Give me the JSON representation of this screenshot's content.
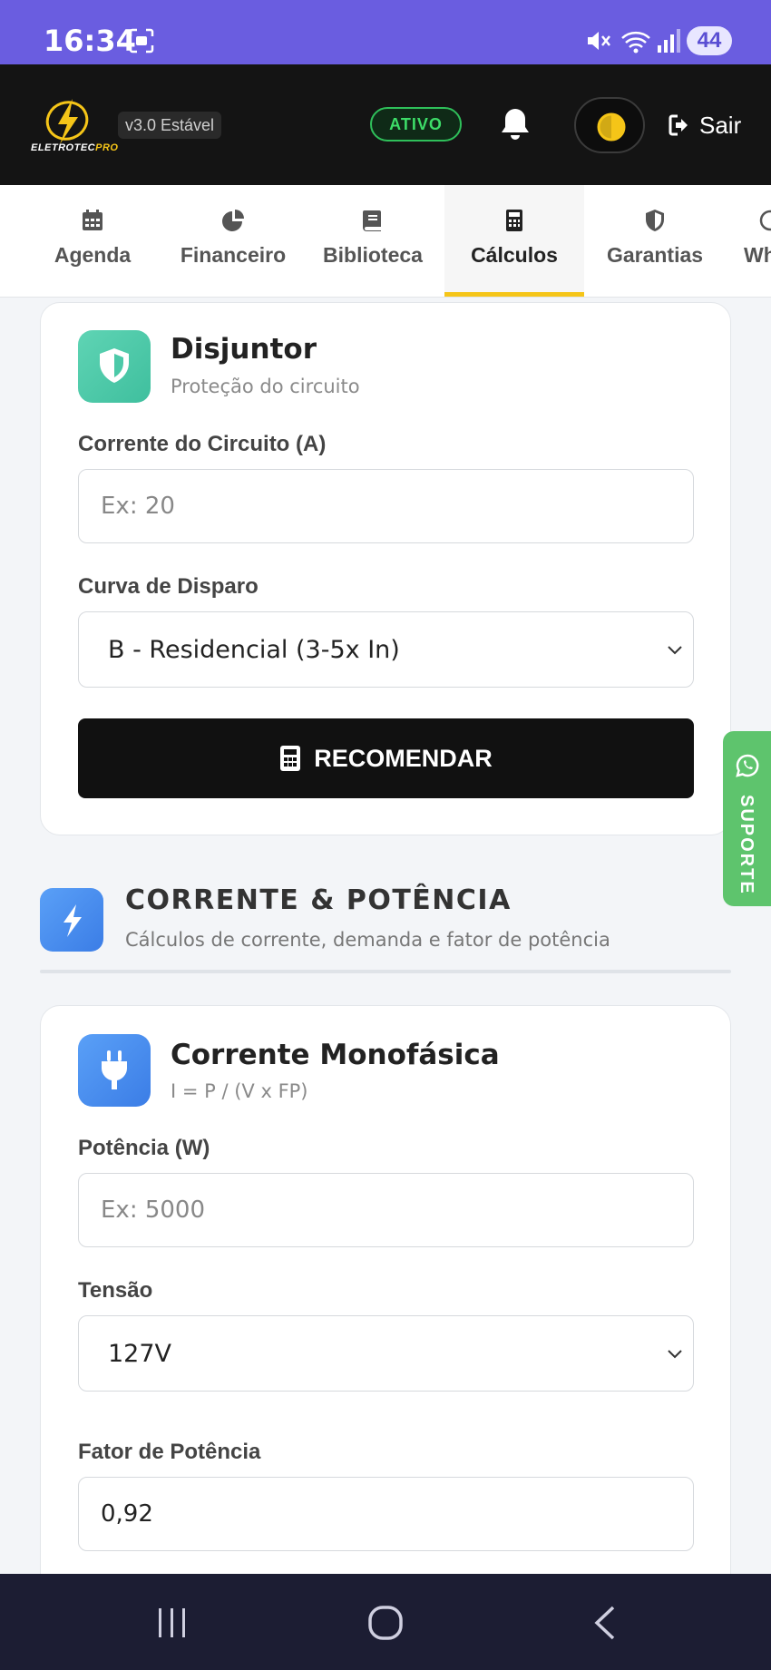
{
  "status_bar": {
    "time": "16:34",
    "battery": "44",
    "icons": [
      "screen-record-icon",
      "mute-icon",
      "wifi-icon",
      "signal-icon",
      "battery-icon"
    ]
  },
  "header": {
    "logo_text_main": "ELETROTEC",
    "logo_text_accent": "PRO",
    "version": "v3.0 Estável",
    "status": "ATIVO",
    "logout_label": "Sair",
    "accent_color": "#f5c518",
    "status_color": "#3ddc68"
  },
  "tabs": [
    {
      "label": "Agenda",
      "icon": "calendar-icon",
      "active": false
    },
    {
      "label": "Financeiro",
      "icon": "pie-chart-icon",
      "active": false
    },
    {
      "label": "Biblioteca",
      "icon": "book-icon",
      "active": false
    },
    {
      "label": "Cálculos",
      "icon": "calculator-icon",
      "active": true
    },
    {
      "label": "Garantias",
      "icon": "shield-icon",
      "active": false
    },
    {
      "label": "WhatsApp",
      "icon": "whatsapp-icon",
      "active": false
    }
  ],
  "breaker_card": {
    "title": "Disjuntor",
    "subtitle": "Proteção do circuito",
    "current_label": "Corrente do Circuito (A)",
    "current_placeholder": "Ex: 20",
    "curve_label": "Curva de Disparo",
    "curve_value": "B - Residencial (3-5x In)",
    "button_label": "RECOMENDAR"
  },
  "section": {
    "title": "CORRENTE & POTÊNCIA",
    "subtitle": "Cálculos de corrente, demanda e fator de potência"
  },
  "single_phase_card": {
    "title": "Corrente Monofásica",
    "formula": "I = P / (V x FP)",
    "power_label": "Potência (W)",
    "power_placeholder": "Ex: 5000",
    "voltage_label": "Tensão",
    "voltage_value": "127V",
    "pf_label": "Fator de Potência",
    "pf_value": "0,92"
  },
  "support": {
    "label": "SUPORTE",
    "color": "#5ec46d"
  }
}
